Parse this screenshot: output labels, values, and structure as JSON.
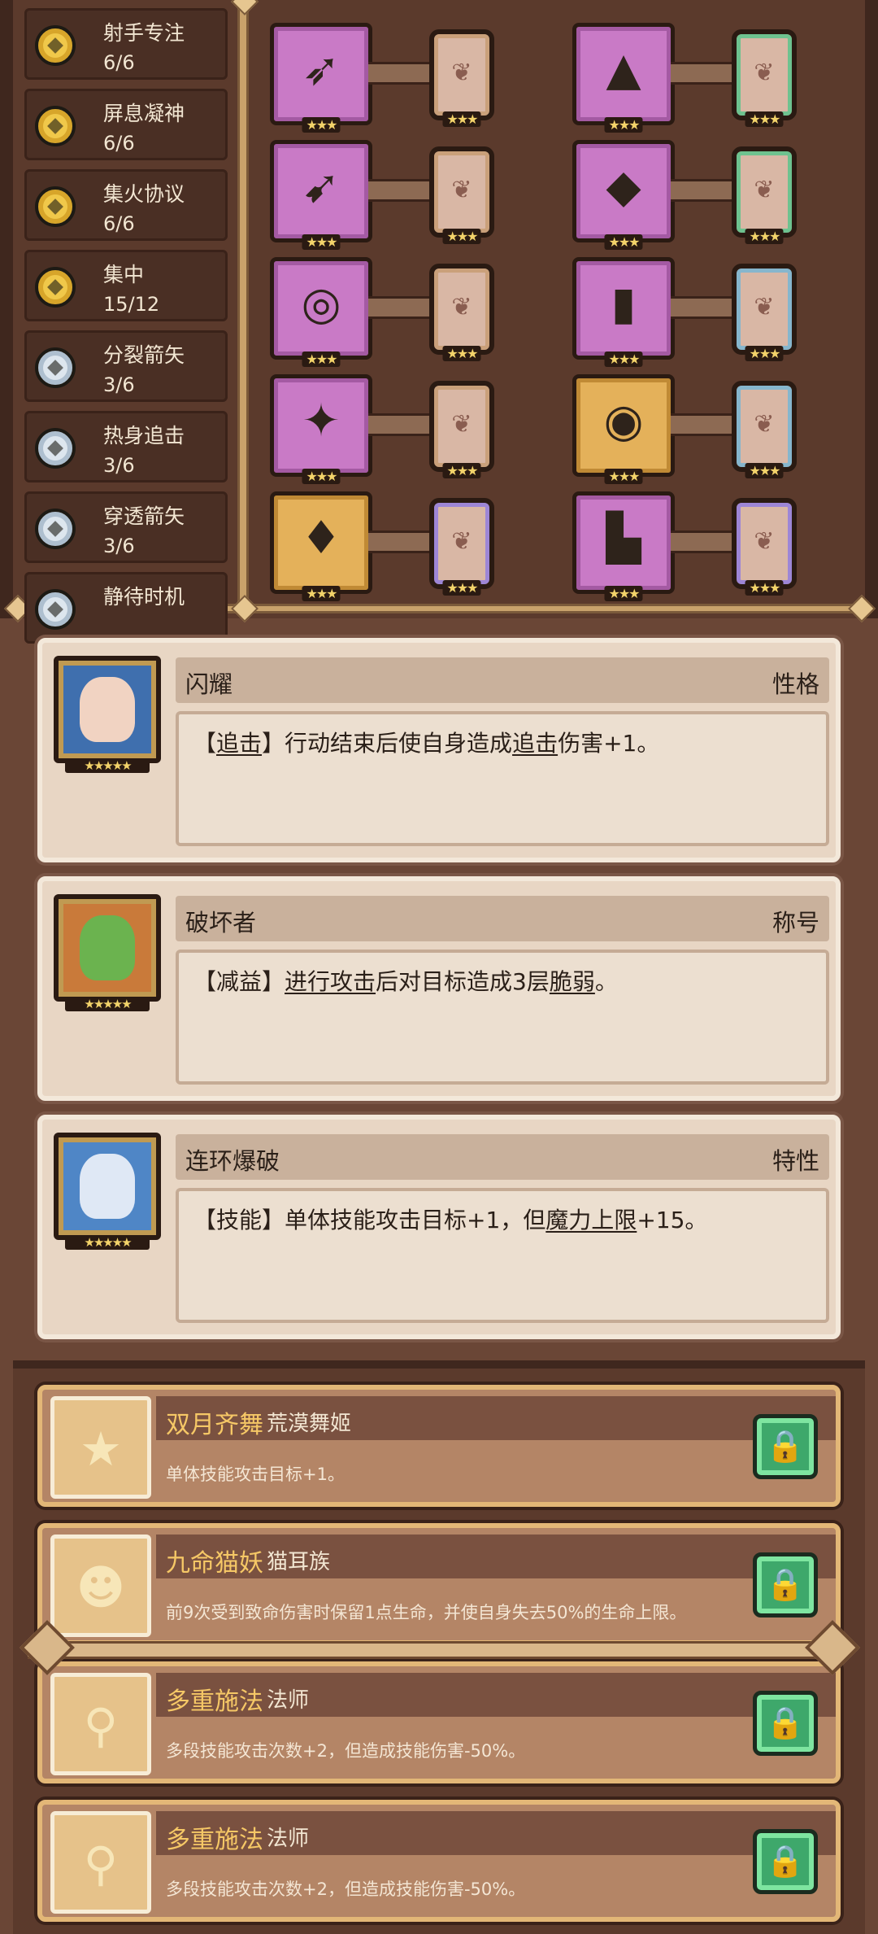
{
  "skills": [
    {
      "name": "射手专注",
      "count": "6/6",
      "icon": "gold-coin-icon",
      "tone": "gold"
    },
    {
      "name": "屏息凝神",
      "count": "6/6",
      "icon": "gold-coin-icon",
      "tone": "gold"
    },
    {
      "name": "集火协议",
      "count": "6/6",
      "icon": "gold-coin-icon",
      "tone": "gold"
    },
    {
      "name": "集中",
      "count": "15/12",
      "icon": "gold-coin-icon",
      "tone": "gold"
    },
    {
      "name": "分裂箭矢",
      "count": "3/6",
      "icon": "silver-coin-icon",
      "tone": "silver"
    },
    {
      "name": "热身追击",
      "count": "3/6",
      "icon": "silver-coin-icon",
      "tone": "silver"
    },
    {
      "name": "穿透箭矢",
      "count": "3/6",
      "icon": "silver-coin-icon",
      "tone": "silver"
    },
    {
      "name": "静待时机",
      "count": "",
      "icon": "silver-coin-icon",
      "tone": "silver"
    }
  ],
  "equipment": [
    {
      "item": "bow-icon",
      "glyph": "➶",
      "rarity": "purple",
      "stars": "★★★",
      "rune": "brown",
      "rune_stars": "★★★"
    },
    {
      "item": "hat-icon",
      "glyph": "▲",
      "rarity": "purple",
      "stars": "★★★",
      "rune": "green",
      "rune_stars": "★★★"
    },
    {
      "item": "arrow-icon",
      "glyph": "➹",
      "rarity": "purple",
      "stars": "★★★",
      "rune": "brown",
      "rune_stars": "★★★"
    },
    {
      "item": "armor-icon",
      "glyph": "◆",
      "rarity": "purple",
      "stars": "★★★",
      "rune": "green",
      "rune_stars": "★★★"
    },
    {
      "item": "necklace-icon",
      "glyph": "◎",
      "rarity": "purple",
      "stars": "★★★",
      "rune": "brown",
      "rune_stars": "★★★"
    },
    {
      "item": "scroll-icon",
      "glyph": "▮",
      "rarity": "purple",
      "stars": "★★★",
      "rune": "blue",
      "rune_stars": "★★★"
    },
    {
      "item": "gem-icon",
      "glyph": "✦",
      "rarity": "purple",
      "stars": "★★★",
      "rune": "brown",
      "rune_stars": "★★★"
    },
    {
      "item": "belt-icon",
      "glyph": "◉",
      "rarity": "gold",
      "stars": "★★★",
      "rune": "blue",
      "rune_stars": "★★★"
    },
    {
      "item": "crystal-icon",
      "glyph": "♦",
      "rarity": "gold",
      "stars": "★★★",
      "rune": "violet",
      "rune_stars": "★★★"
    },
    {
      "item": "boots-icon",
      "glyph": "▙",
      "rarity": "purple",
      "stars": "★★★",
      "rune": "violet",
      "rune_stars": "★★★"
    }
  ],
  "traits": [
    {
      "name": "闪耀",
      "type": "性格",
      "tag": "【",
      "tag_word": "追击",
      "tag_end": "】",
      "text1": "行动结束后使自身造成",
      "u1": "追击",
      "text2": "伤害+1。",
      "u2": "",
      "text3": "",
      "stars": "★★★★★",
      "portrait_bg": "#3f6fae",
      "face": "#f1d3c2"
    },
    {
      "name": "破坏者",
      "type": "称号",
      "tag": "【减益】",
      "tag_word": "",
      "tag_end": "",
      "text1": "",
      "u1": "进行攻击",
      "text2": "后对目标造成3层",
      "u2": "脆弱",
      "text3": "。",
      "stars": "★★★★★",
      "portrait_bg": "#c97a3a",
      "face": "#6bb34f"
    },
    {
      "name": "连环爆破",
      "type": "特性",
      "tag": "【技能】",
      "tag_word": "",
      "tag_end": "",
      "text1": "单体技能攻击目标+1，但",
      "u1": "魔力上限",
      "text2": "+15。",
      "u2": "",
      "text3": "",
      "stars": "★★★★★",
      "portrait_bg": "#4f86c6",
      "face": "#dfe8f5"
    }
  ],
  "bonds": [
    {
      "name": "双月齐舞",
      "tribe": "荒漠舞姬",
      "desc": "单体技能攻击目标+1。",
      "icon": "star-icon",
      "glyph": "★",
      "locked": true
    },
    {
      "name": "九命猫妖",
      "tribe": "猫耳族",
      "desc": "前9次受到致命伤害时保留1点生命，并使自身失去50%的生命上限。",
      "icon": "cat-face-icon",
      "glyph": "☻",
      "locked": true
    },
    {
      "name": "多重施法",
      "tribe": "法师",
      "desc": "多段技能攻击次数+2，但造成技能伤害-50%。",
      "icon": "wand-icon",
      "glyph": "⚲",
      "locked": true
    },
    {
      "name": "多重施法",
      "tribe": "法师",
      "desc": "多段技能攻击次数+2，但造成技能伤害-50%。",
      "icon": "wand-icon",
      "glyph": "⚲",
      "locked": true
    }
  ],
  "lock_glyph": "🔒"
}
